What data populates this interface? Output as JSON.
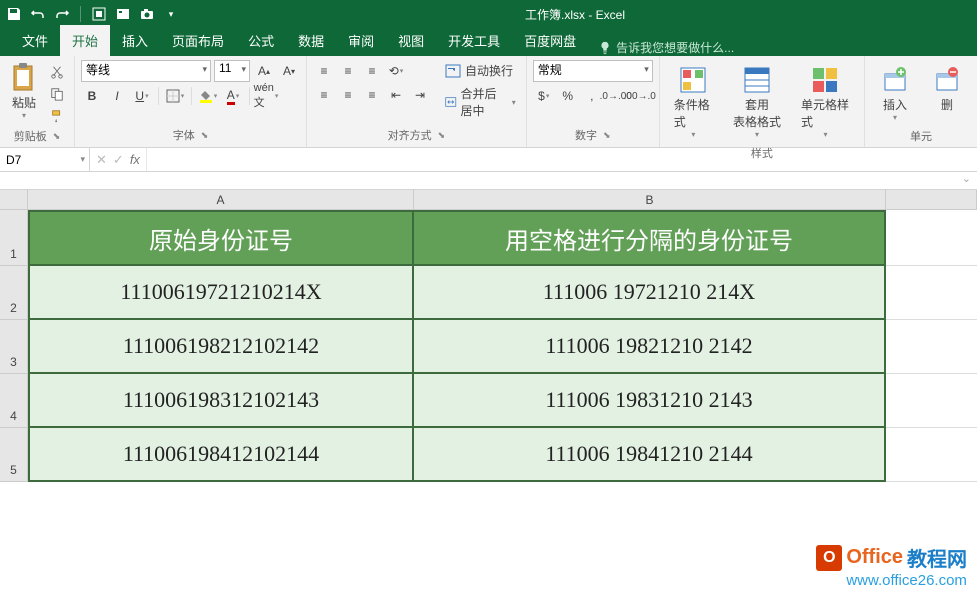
{
  "title": "工作簿.xlsx - Excel",
  "tabs": {
    "file": "文件",
    "home": "开始",
    "insert": "插入",
    "layout": "页面布局",
    "formulas": "公式",
    "data": "数据",
    "review": "审阅",
    "view": "视图",
    "dev": "开发工具",
    "netdisk": "百度网盘",
    "tellme": "告诉我您想要做什么..."
  },
  "groups": {
    "clipboard": "剪贴板",
    "font": "字体",
    "align": "对齐方式",
    "number": "数字",
    "styles": "样式",
    "cells": "单元"
  },
  "clipboard": {
    "paste": "粘贴"
  },
  "font": {
    "name": "等线",
    "size": "11"
  },
  "align": {
    "wrap": "自动换行",
    "merge": "合并后居中"
  },
  "number": {
    "format": "常规"
  },
  "styles": {
    "conditional": "条件格式",
    "table": "套用\n表格格式",
    "cell": "单元格样式"
  },
  "cells": {
    "insert": "插入",
    "delete": "删"
  },
  "namebox": "D7",
  "columns": {
    "A": "A",
    "B": "B"
  },
  "rows": [
    "1",
    "2",
    "3",
    "4",
    "5"
  ],
  "headers": {
    "a": "原始身份证号",
    "b": "用空格进行分隔的身份证号"
  },
  "data_rows": [
    {
      "a": "11100619721210214X",
      "b": "111006  19721210  214X"
    },
    {
      "a": "111006198212102142",
      "b": "111006  19821210  2142"
    },
    {
      "a": "111006198312102143",
      "b": "111006  19831210  2143"
    },
    {
      "a": "111006198412102144",
      "b": "111006  19841210  2144"
    }
  ],
  "watermark": {
    "brand1": "Office",
    "brand2": "教程网",
    "url": "www.office26.com"
  }
}
